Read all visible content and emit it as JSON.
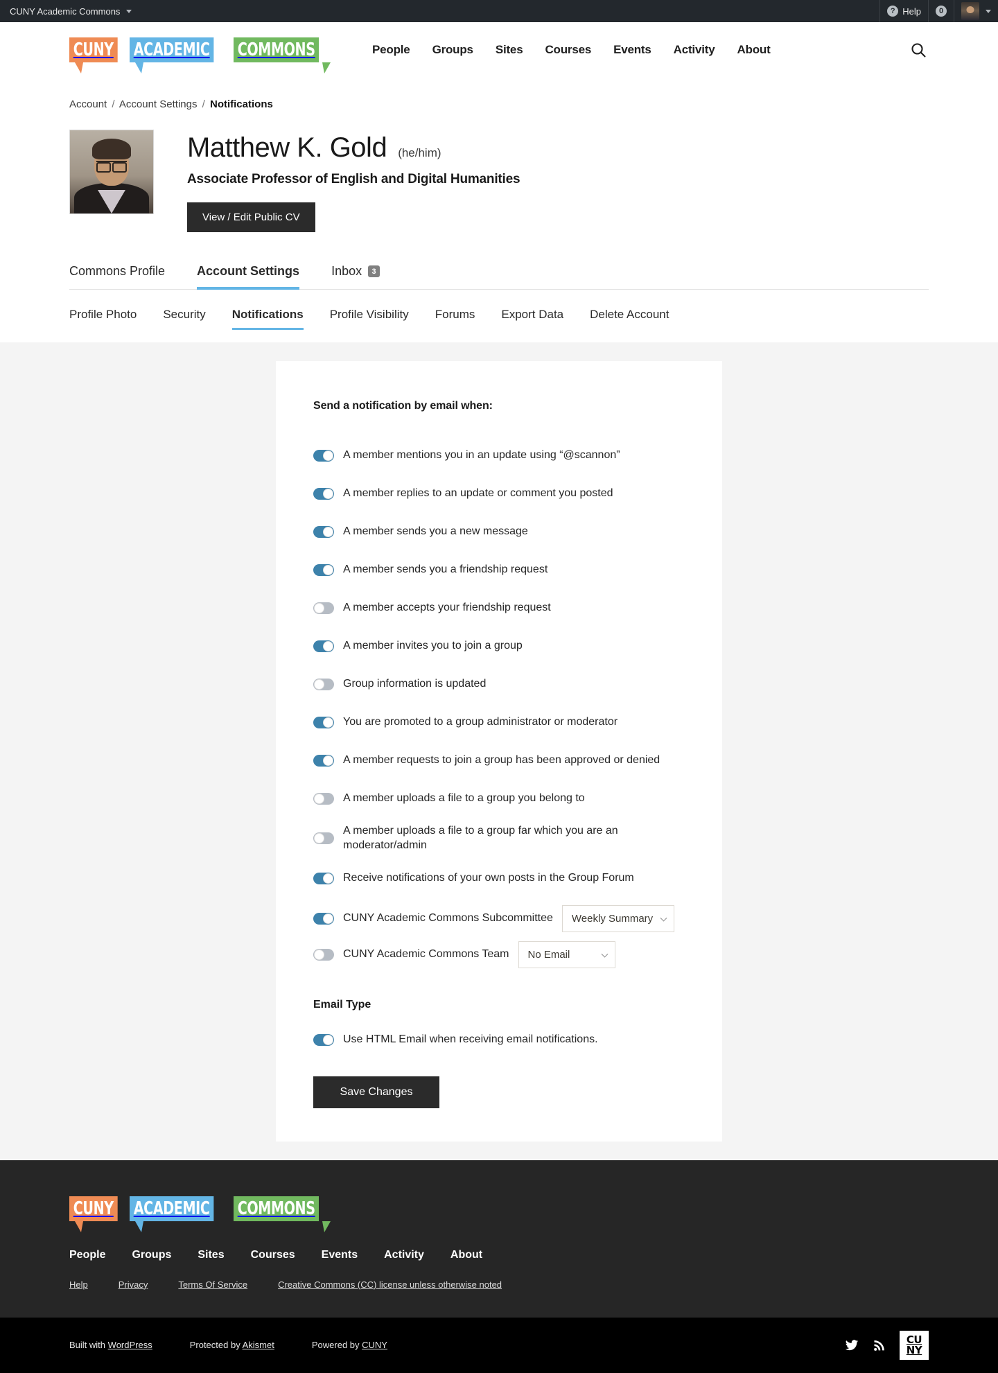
{
  "adminbar": {
    "site_name": "CUNY Academic Commons",
    "help_label": "Help",
    "help_icon": "question-mark-icon",
    "notification_count": "0"
  },
  "header": {
    "logo": {
      "part1": "CUNY",
      "part2": "ACADEMIC",
      "part3": "COMMONS"
    },
    "nav": [
      {
        "label": "People"
      },
      {
        "label": "Groups"
      },
      {
        "label": "Sites"
      },
      {
        "label": "Courses"
      },
      {
        "label": "Events"
      },
      {
        "label": "Activity"
      },
      {
        "label": "About"
      }
    ],
    "search_icon": "search-icon"
  },
  "breadcrumb": {
    "item1": "Account",
    "item2": "Account Settings",
    "current": "Notifications",
    "sep": "/"
  },
  "profile": {
    "name": "Matthew K. Gold",
    "pronouns": "(he/him)",
    "title": "Associate Professor of English and Digital Humanities",
    "cv_button": "View / Edit Public CV"
  },
  "tabs_primary": [
    {
      "label": "Commons Profile",
      "active": false,
      "badge": ""
    },
    {
      "label": "Account Settings",
      "active": true,
      "badge": ""
    },
    {
      "label": "Inbox",
      "active": false,
      "badge": "3"
    }
  ],
  "tabs_secondary": [
    {
      "label": "Profile Photo",
      "active": false
    },
    {
      "label": "Security",
      "active": false
    },
    {
      "label": "Notifications",
      "active": true
    },
    {
      "label": "Profile Visibility",
      "active": false
    },
    {
      "label": "Forums",
      "active": false
    },
    {
      "label": "Export Data",
      "active": false
    },
    {
      "label": "Delete Account",
      "active": false
    }
  ],
  "notifications": {
    "section_title": "Send a notification by email when:",
    "options": [
      {
        "label": "A member mentions you in an update using “@scannon”",
        "state": "on"
      },
      {
        "label": "A member replies to an update or comment you posted",
        "state": "on"
      },
      {
        "label": "A member sends you a new message",
        "state": "on"
      },
      {
        "label": "A member sends you a friendship request",
        "state": "on"
      },
      {
        "label": "A member accepts your friendship request",
        "state": "off"
      },
      {
        "label": "A member invites you to join a group",
        "state": "on"
      },
      {
        "label": "Group information is updated",
        "state": "off"
      },
      {
        "label": "You are promoted to a group administrator or moderator",
        "state": "on"
      },
      {
        "label": "A member requests to join a group has been approved or denied",
        "state": "on"
      },
      {
        "label": "A member uploads a file to a group you belong to",
        "state": "off"
      },
      {
        "label": "A member uploads a file to a group far which you are an moderator/admin",
        "state": "off"
      },
      {
        "label": "Receive notifications of your own posts in the Group Forum",
        "state": "on"
      }
    ],
    "group_options": [
      {
        "label": "CUNY Academic Commons Subcommittee",
        "state": "on",
        "select_value": "Weekly Summary"
      },
      {
        "label": "CUNY Academic Commons Team",
        "state": "off",
        "select_value": "No Email"
      }
    ],
    "email_type_title": "Email Type",
    "email_type_option": {
      "label": "Use HTML Email when receiving email notifications.",
      "state": "on"
    },
    "save_button": "Save Changes"
  },
  "footer": {
    "logo": {
      "part1": "CUNY",
      "part2": "ACADEMIC",
      "part3": "COMMONS"
    },
    "nav": [
      {
        "label": "People"
      },
      {
        "label": "Groups"
      },
      {
        "label": "Sites"
      },
      {
        "label": "Courses"
      },
      {
        "label": "Events"
      },
      {
        "label": "Activity"
      },
      {
        "label": "About"
      }
    ],
    "links": [
      {
        "label": "Help"
      },
      {
        "label": "Privacy"
      },
      {
        "label": "Terms Of Service"
      },
      {
        "label": "Creative Commons (CC) license unless otherwise noted"
      }
    ]
  },
  "bottom_bar": {
    "built_prefix": "Built with",
    "built_link": "WordPress",
    "protected_prefix": "Protected by",
    "protected_link": "Akismet",
    "powered_prefix": "Powered by",
    "powered_link": "CUNY",
    "twitter_icon": "twitter-icon",
    "rss_icon": "rss-icon",
    "cuny_line1": "CU",
    "cuny_line2": "NY"
  },
  "colors": {
    "logo_orange": "#ef8b54",
    "logo_blue": "#63b5e5",
    "logo_green": "#71b95f",
    "toggle_on": "#3d82ab",
    "toggle_off": "#b6bcc4",
    "accent_underline": "#63b5e5",
    "dark_button": "#2b2b2b"
  }
}
